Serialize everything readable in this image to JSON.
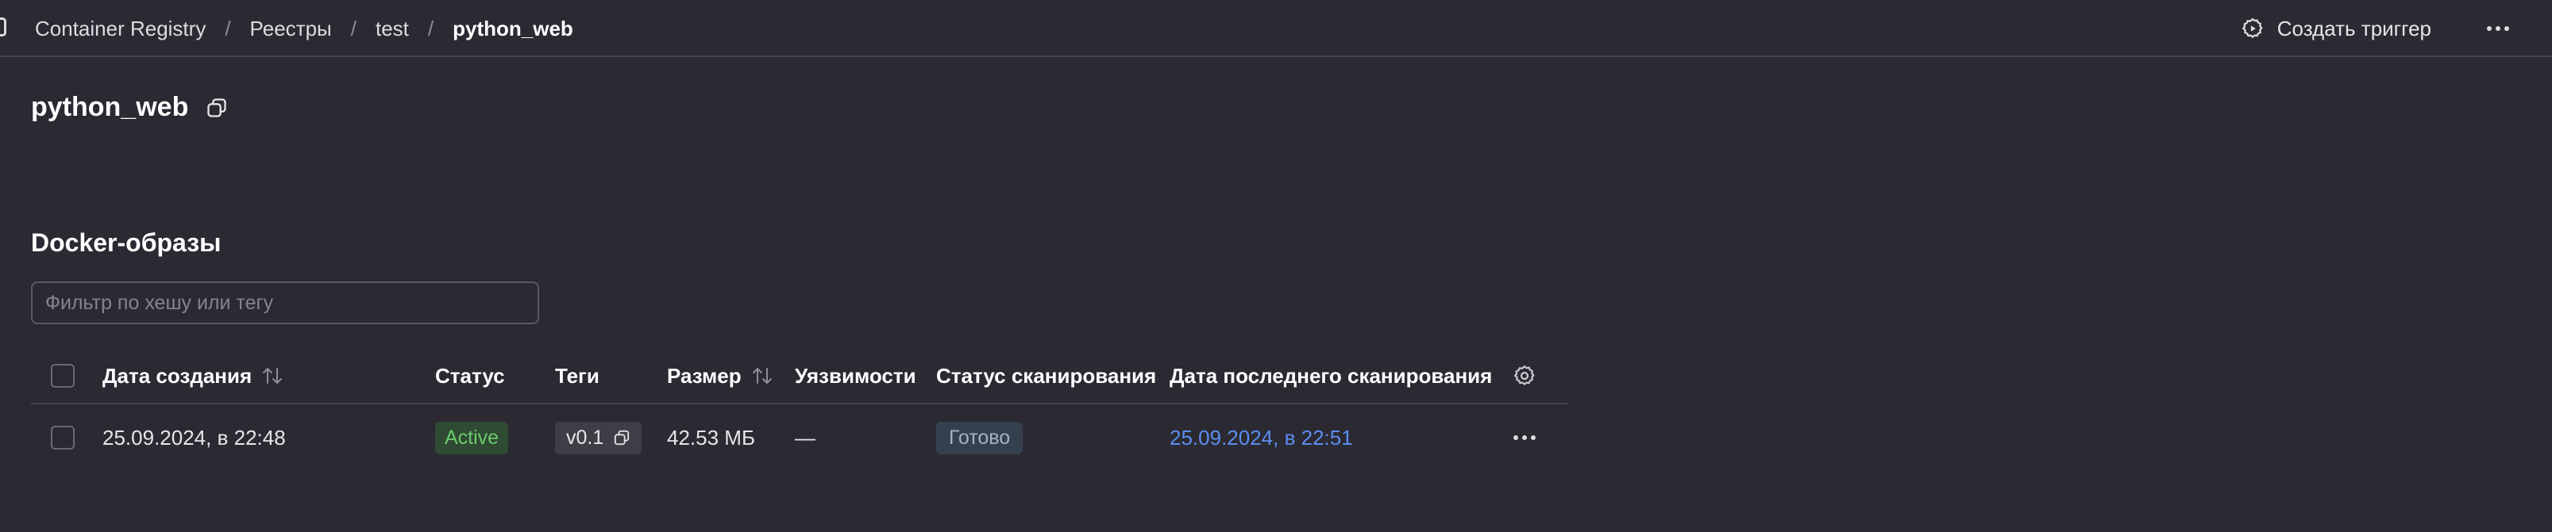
{
  "breadcrumb": {
    "items": [
      "Container Registry",
      "Реестры",
      "test"
    ],
    "separator": "/",
    "current": "python_web"
  },
  "header": {
    "trigger_label": "Создать триггер",
    "trigger_icon": "gear-play-icon",
    "more_icon": "ellipsis-icon"
  },
  "page": {
    "title": "python_web",
    "copy_icon": "copy-icon"
  },
  "section": {
    "title": "Docker-образы"
  },
  "filter": {
    "placeholder": "Фильтр по хешу или тегу",
    "value": ""
  },
  "table": {
    "columns": [
      "Дата создания",
      "Статус",
      "Теги",
      "Размер",
      "Уязвимости",
      "Статус сканирования",
      "Дата последнего сканирования"
    ],
    "settings_icon": "gear-icon",
    "rows": [
      {
        "created": "25.09.2024, в 22:48",
        "status": "Active",
        "tag": "v0.1",
        "size": "42.53 МБ",
        "vulnerabilities": "—",
        "scan_status": "Готово",
        "last_scan": "25.09.2024, в 22:51"
      }
    ]
  },
  "colors": {
    "background": "#2b2a33",
    "active_green": "#6cc96e",
    "link_blue": "#5b8def"
  }
}
